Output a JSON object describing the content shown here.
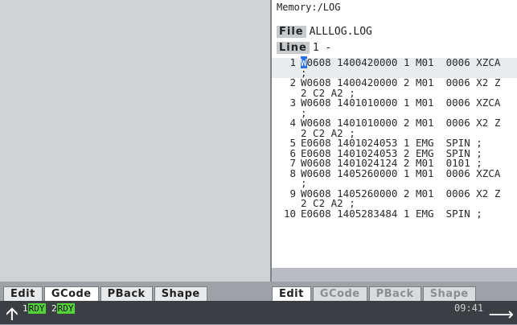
{
  "log_panel": {
    "memory_path": "Memory:/LOG",
    "file_label": "File",
    "file_name": "ALLLOG.LOG",
    "line_label": "Line",
    "line_value": "1 -",
    "rows": [
      {
        "n": "1",
        "cursor": "W",
        "rest": "0608 1400420000 1 M01  0006 XZCA"
      },
      {
        "n": "",
        "text": ";"
      },
      {
        "n": "2",
        "text": "W0608 1400420000 2 M01  0006 X2 Z"
      },
      {
        "n": "",
        "text": "2 C2 A2 ;"
      },
      {
        "n": "3",
        "text": "W0608 1401010000 1 M01  0006 XZCA"
      },
      {
        "n": "",
        "text": ";"
      },
      {
        "n": "4",
        "text": "W0608 1401010000 2 M01  0006 X2 Z"
      },
      {
        "n": "",
        "text": "2 C2 A2 ;"
      },
      {
        "n": "5",
        "text": "E0608 1401024053 1 EMG  SPIN ;"
      },
      {
        "n": "6",
        "text": "E0608 1401024053 2 EMG  SPIN ;"
      },
      {
        "n": "7",
        "text": "W0608 1401024124 2 M01  0101 ;"
      },
      {
        "n": "8",
        "text": "W0608 1405260000 1 M01  0006 XZCA"
      },
      {
        "n": "",
        "text": ";"
      },
      {
        "n": "9",
        "text": "W0608 1405260000 2 M01  0006 X2 Z"
      },
      {
        "n": "",
        "text": "2 C2 A2 ;"
      },
      {
        "n": "10",
        "text": "E0608 1405283484 1 EMG  SPIN ;"
      }
    ]
  },
  "left_tabs": [
    "Edit",
    "GCode",
    "PBack",
    "Shape"
  ],
  "right_tabs": [
    "Edit",
    "GCode",
    "PBack",
    "Shape"
  ],
  "status": {
    "ch1_num": "1",
    "ch1_tag": "RDY",
    "ch2_num": "2",
    "ch2_tag": "RDY",
    "time": "09:41"
  }
}
